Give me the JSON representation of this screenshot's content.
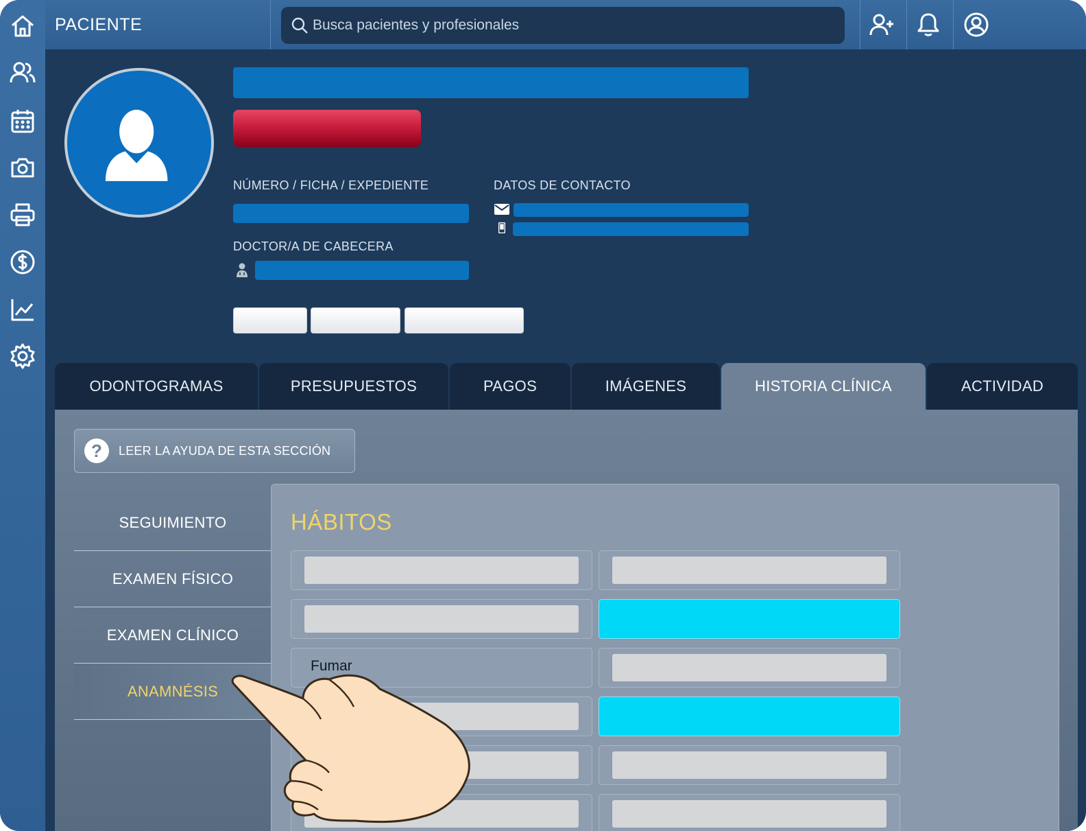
{
  "header": {
    "title": "PACIENTE",
    "search_placeholder": "Busca pacientes y profesionales"
  },
  "sidebar": {
    "items": [
      "home-icon",
      "users-icon",
      "calendar-icon",
      "camera-icon",
      "printer-icon",
      "dollar-icon",
      "chart-icon",
      "gear-icon"
    ]
  },
  "topbar_icons": [
    "add-user-icon",
    "bell-icon",
    "account-icon"
  ],
  "profile": {
    "number_label": "NÚMERO / FICHA / EXPEDIENTE",
    "contact_label": "DATOS DE CONTACTO",
    "doctor_label": "DOCTOR/A DE CABECERA"
  },
  "tabs": [
    {
      "label": "ODONTOGRAMAS"
    },
    {
      "label": "PRESUPUESTOS"
    },
    {
      "label": "PAGOS"
    },
    {
      "label": "IMÁGENES"
    },
    {
      "label": "HISTORIA CLÍNICA",
      "active": true
    },
    {
      "label": "ACTIVIDAD"
    }
  ],
  "help": {
    "label": "LEER LA AYUDA DE ESTA SECCIÓN",
    "icon": "?"
  },
  "submenu": [
    {
      "label": "SEGUIMIENTO"
    },
    {
      "label": "EXAMEN FÍSICO"
    },
    {
      "label": "EXAMEN CLÍNICO"
    },
    {
      "label": "ANAMNÉSIS",
      "active": true
    }
  ],
  "panel": {
    "title": "HÁBITOS",
    "visible_field_label": "Fumar"
  },
  "colors": {
    "active_tab_text": "#ffffff",
    "accent_yellow": "#f0d36a",
    "highlight_cyan": "#00d8f8",
    "redaction_blue": "#0b72be",
    "redaction_red": "#c81e3c"
  }
}
